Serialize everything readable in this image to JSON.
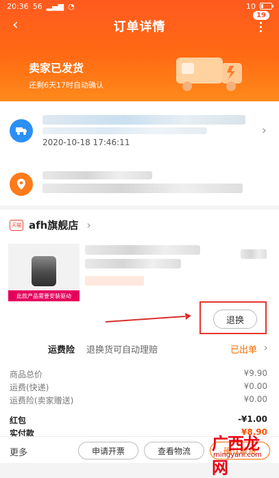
{
  "status_bar": {
    "time": "20:36",
    "signal": "56",
    "battery_label": "10"
  },
  "nav": {
    "back_icon": "‹",
    "title": "订单详情",
    "badge": "19"
  },
  "shipping": {
    "title": "卖家已发货",
    "subtitle": "还剩6天17时自动确认"
  },
  "logistics": {
    "time": "2020-10-18 17:46:11"
  },
  "shop": {
    "logo_text": "天猫",
    "name": "afh旗舰店"
  },
  "product": {
    "caption": "此款产品需要安装驱动"
  },
  "actions": {
    "return_label": "退换"
  },
  "insurance": {
    "label": "运费险",
    "desc": "退换货可自动理赔",
    "status": "已出单"
  },
  "fees": [
    {
      "label": "商品总价",
      "value": "¥9.90"
    },
    {
      "label": "运费(快递)",
      "value": "¥0.00"
    },
    {
      "label": "运费险(卖家赠送)",
      "value": "¥0.00"
    },
    {
      "label": "红包",
      "value": "-¥1.00"
    },
    {
      "label": "实付款",
      "value": "¥8.90"
    }
  ],
  "footer": {
    "more": "更多",
    "invoice": "申请开票",
    "logistics": "查看物流",
    "confirm": "确认收货"
  },
  "watermark": {
    "text": "广西龙网",
    "url": "mingyanl.com"
  },
  "battery_level": 0.2
}
